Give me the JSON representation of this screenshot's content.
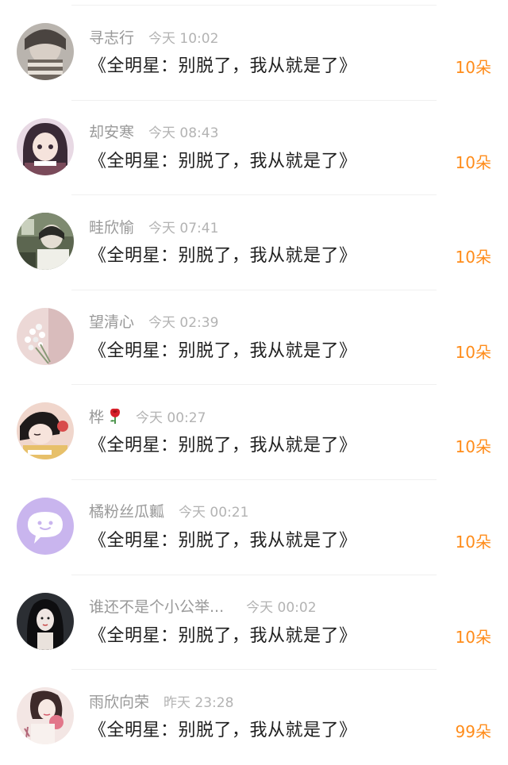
{
  "flower_rows": [
    {
      "username": "寻志行",
      "time": "今天 10:02",
      "title": "《全明星：别脱了，我从就是了》",
      "count": "10朵",
      "avatar": "girl-photo"
    },
    {
      "username": "却安寒",
      "time": "今天 08:43",
      "title": "《全明星：别脱了，我从就是了》",
      "count": "10朵",
      "avatar": "anime-girl"
    },
    {
      "username": "畦欣愉",
      "time": "今天 07:41",
      "title": "《全明星：别脱了，我从就是了》",
      "count": "10朵",
      "avatar": "dark-room"
    },
    {
      "username": "望清心",
      "time": "今天 02:39",
      "title": "《全明星：别脱了，我从就是了》",
      "count": "10朵",
      "avatar": "flowers"
    },
    {
      "username": "桦",
      "time": "今天 00:27",
      "title": "《全明星：别脱了，我从就是了》",
      "count": "10朵",
      "avatar": "sleeping-girl",
      "username_icon": "rose-icon"
    },
    {
      "username": "橘粉丝瓜瓤",
      "time": "今天 00:21",
      "title": "《全明星：别脱了，我从就是了》",
      "count": "10朵",
      "avatar": "chat-bubble"
    },
    {
      "username": "谁还不是个小公举...",
      "time": "今天 00:02",
      "title": "《全明星：别脱了，我从就是了》",
      "count": "10朵",
      "avatar": "dark-hair-girl"
    },
    {
      "username": "雨欣向荣",
      "time": "昨天 23:28",
      "title": "《全明星：别脱了，我从就是了》",
      "count": "99朵",
      "avatar": "painted-girl"
    }
  ],
  "colors": {
    "count_orange": "#ff8c1a",
    "username_gray": "#999999",
    "time_gray": "#b3b3b3",
    "title_dark": "#1f1f1f",
    "chat_avatar_purple": "#c9b5ee"
  }
}
